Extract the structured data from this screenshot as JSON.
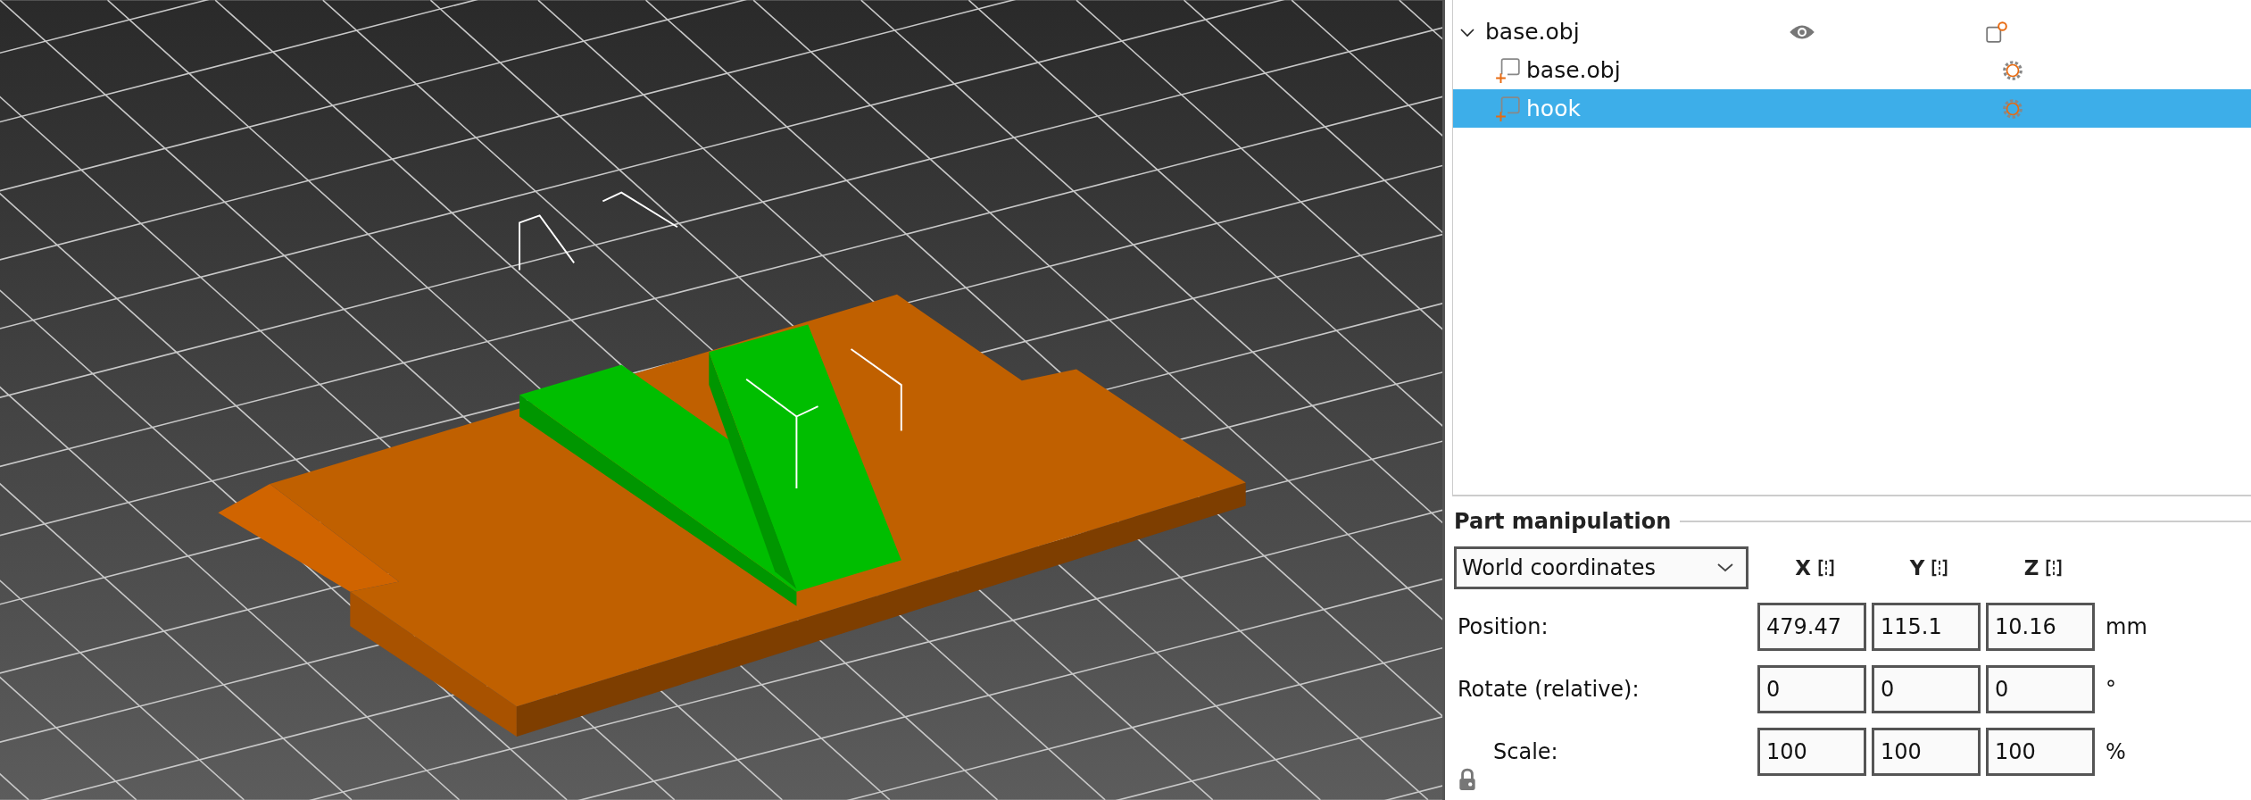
{
  "object_list": {
    "items": [
      {
        "label": "base.obj",
        "expanded": true,
        "visible": true,
        "children": [
          {
            "label": "base.obj",
            "selected": false
          },
          {
            "label": "hook",
            "selected": true
          }
        ]
      }
    ]
  },
  "part_manipulation": {
    "title": "Part manipulation",
    "coordinate_system": "World coordinates",
    "axes": [
      "X",
      "Y",
      "Z"
    ],
    "rows": [
      {
        "label": "Position:",
        "values": [
          "479.47",
          "115.1",
          "10.16"
        ],
        "unit": "mm",
        "locked": false
      },
      {
        "label": "Rotate (relative):",
        "values": [
          "0",
          "0",
          "0"
        ],
        "unit": "°",
        "locked": false
      },
      {
        "label": "Scale:",
        "values": [
          "100",
          "100",
          "100"
        ],
        "unit": "%",
        "locked": true
      }
    ]
  }
}
